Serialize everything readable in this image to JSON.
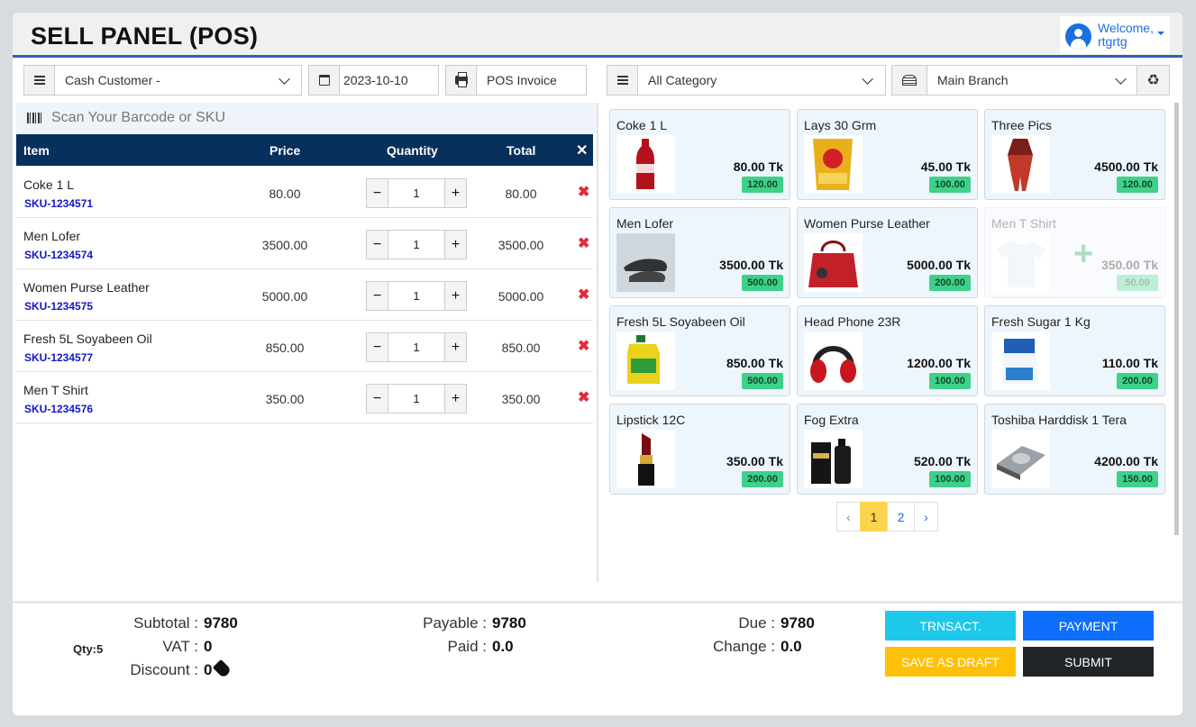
{
  "header": {
    "title": "SELL PANEL (POS)",
    "welcome": "Welcome,",
    "user": "rtgrtg"
  },
  "controls": {
    "customer": "Cash Customer -",
    "date": "2023-10-10",
    "invoice": "POS Invoice",
    "category": "All Category",
    "branch": "Main Branch"
  },
  "scan": {
    "placeholder": "Scan Your Barcode or SKU"
  },
  "cart": {
    "headers": {
      "item": "Item",
      "price": "Price",
      "quantity": "Quantity",
      "total": "Total",
      "close": "✕"
    },
    "rows": [
      {
        "name": "Coke 1 L",
        "sku": "SKU-1234571",
        "price": "80.00",
        "qty": "1",
        "total": "80.00"
      },
      {
        "name": "Men Lofer",
        "sku": "SKU-1234574",
        "price": "3500.00",
        "qty": "1",
        "total": "3500.00"
      },
      {
        "name": "Women Purse Leather",
        "sku": "SKU-1234575",
        "price": "5000.00",
        "qty": "1",
        "total": "5000.00"
      },
      {
        "name": "Fresh 5L Soyabeen Oil",
        "sku": "SKU-1234577",
        "price": "850.00",
        "qty": "1",
        "total": "850.00"
      },
      {
        "name": "Men T Shirt",
        "sku": "SKU-1234576",
        "price": "350.00",
        "qty": "1",
        "total": "350.00"
      }
    ],
    "minus": "−",
    "plus": "+",
    "remove": "✖"
  },
  "products": [
    {
      "name": "Coke 1 L",
      "price": "80.00 Tk",
      "stock": "120.00",
      "icon": "coke-bottle-image"
    },
    {
      "name": "Lays 30 Grm",
      "price": "45.00 Tk",
      "stock": "100.00",
      "icon": "chips-bag-image"
    },
    {
      "name": "Three Pics",
      "price": "4500.00 Tk",
      "stock": "120.00",
      "icon": "dress-image"
    },
    {
      "name": "Men Lofer",
      "price": "3500.00 Tk",
      "stock": "500.00",
      "icon": "loafer-shoe-image"
    },
    {
      "name": "Women Purse Leather",
      "price": "5000.00 Tk",
      "stock": "200.00",
      "icon": "handbag-image"
    },
    {
      "name": "Men T Shirt",
      "price": "350.00 Tk",
      "stock": "50.00",
      "icon": "tshirt-image",
      "disabled": true
    },
    {
      "name": "Fresh 5L Soyabeen Oil",
      "price": "850.00 Tk",
      "stock": "500.00",
      "icon": "oil-bottle-image"
    },
    {
      "name": "Head Phone 23R",
      "price": "1200.00 Tk",
      "stock": "100.00",
      "icon": "headphone-image"
    },
    {
      "name": "Fresh Sugar 1 Kg",
      "price": "110.00 Tk",
      "stock": "200.00",
      "icon": "sugar-pack-image"
    },
    {
      "name": "Lipstick 12C",
      "price": "350.00 Tk",
      "stock": "200.00",
      "icon": "lipstick-image"
    },
    {
      "name": "Fog Extra",
      "price": "520.00 Tk",
      "stock": "100.00",
      "icon": "perfume-image"
    },
    {
      "name": "Toshiba Harddisk 1 Tera",
      "price": "4200.00 Tk",
      "stock": "150.00",
      "icon": "harddisk-image"
    }
  ],
  "pagination": {
    "prev": "‹",
    "pages": [
      "1",
      "2"
    ],
    "next": "›",
    "current": "1"
  },
  "summary": {
    "qty": "Qty:5",
    "subtotal_label": "Subtotal :",
    "subtotal": "9780",
    "vat_label": "VAT :",
    "vat": "0",
    "discount_label": "Discount :",
    "discount": "0",
    "payable_label": "Payable :",
    "payable": "9780",
    "paid_label": "Paid :",
    "paid": "0.0",
    "due_label": "Due :",
    "due": "9780",
    "change_label": "Change :",
    "change": "0.0"
  },
  "actions": {
    "transact": "TRNSACT.",
    "payment": "PAYMENT",
    "draft": "SAVE AS DRAFT",
    "submit": "SUBMIT"
  },
  "colors": {
    "header_border": "#2c63b0",
    "table_head": "#08305c",
    "stock_badge": "#3fd08a",
    "transact": "#1ec8ea",
    "payment": "#0d6efd",
    "draft": "#ffc107",
    "submit": "#212529"
  }
}
